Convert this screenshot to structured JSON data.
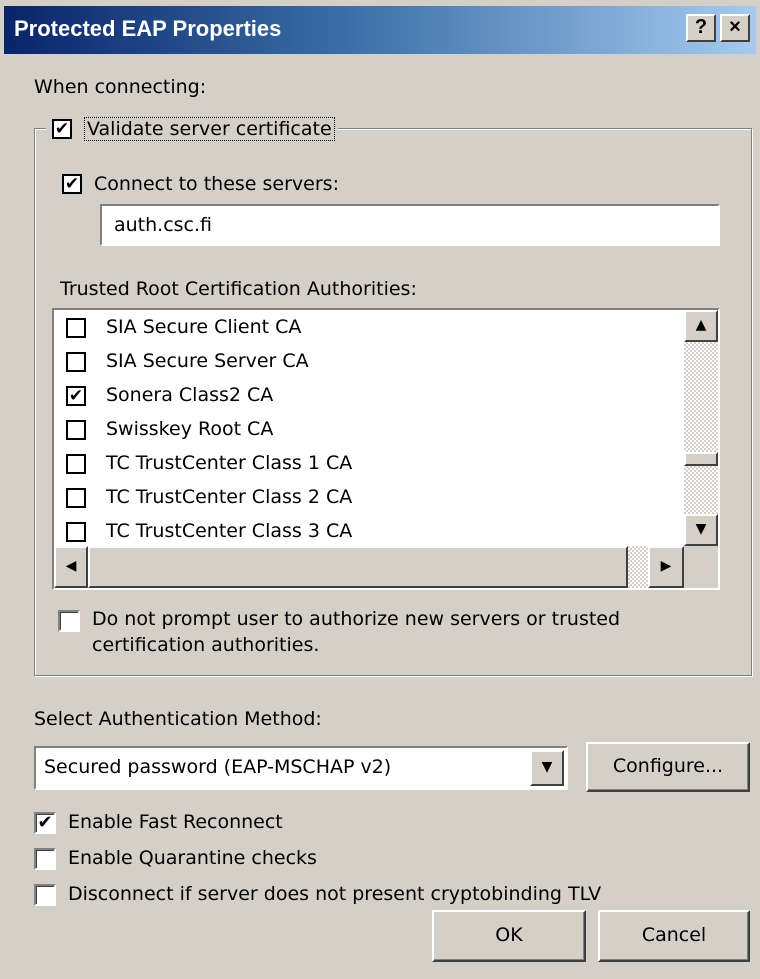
{
  "window": {
    "title": "Protected EAP Properties",
    "help_btn": "?",
    "close_btn": "×"
  },
  "when_connecting": "When connecting:",
  "validate": {
    "label": "Validate server certificate",
    "checked": true
  },
  "connect": {
    "label": "Connect to these servers:",
    "checked": true,
    "value": "auth.csc.fi"
  },
  "trusted_label": "Trusted Root Certification Authorities:",
  "ca_list": [
    {
      "label": "SIA Secure Client CA",
      "checked": false
    },
    {
      "label": "SIA Secure Server CA",
      "checked": false
    },
    {
      "label": "Sonera Class2 CA",
      "checked": true
    },
    {
      "label": "Swisskey Root CA",
      "checked": false
    },
    {
      "label": "TC TrustCenter Class 1 CA",
      "checked": false
    },
    {
      "label": "TC TrustCenter Class 2 CA",
      "checked": false
    },
    {
      "label": "TC TrustCenter Class 3 CA",
      "checked": false
    }
  ],
  "do_not_prompt": {
    "line1": "Do not prompt user to authorize new servers or trusted",
    "line2": "certification authorities.",
    "checked": false
  },
  "auth_method_label": "Select Authentication Method:",
  "auth_method_value": "Secured password (EAP-MSCHAP v2)",
  "configure_label": "Configure...",
  "options": [
    {
      "label": "Enable Fast Reconnect",
      "checked": true
    },
    {
      "label": "Enable Quarantine checks",
      "checked": false
    },
    {
      "label": "Disconnect if server does not present cryptobinding TLV",
      "checked": false
    }
  ],
  "ok_label": "OK",
  "cancel_label": "Cancel",
  "check_glyph": "✔"
}
